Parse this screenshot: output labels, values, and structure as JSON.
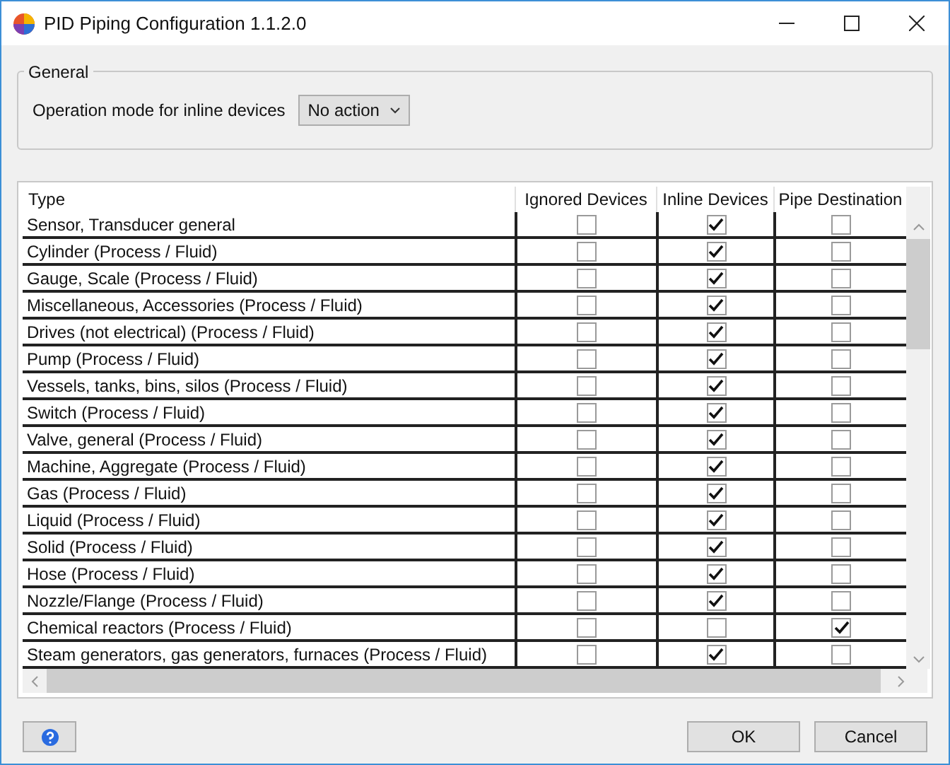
{
  "window": {
    "title": "PID Piping Configuration 1.1.2.0"
  },
  "general": {
    "title": "General",
    "label": "Operation mode for inline devices",
    "value": "No action"
  },
  "table": {
    "columns": [
      "Type",
      "Ignored Devices",
      "Inline Devices",
      "Pipe Destination"
    ],
    "rows": [
      {
        "type": "Sensor, Transducer general",
        "ignored": false,
        "inline": true,
        "pipe_destination": false
      },
      {
        "type": "Cylinder (Process / Fluid)",
        "ignored": false,
        "inline": true,
        "pipe_destination": false
      },
      {
        "type": "Gauge, Scale (Process / Fluid)",
        "ignored": false,
        "inline": true,
        "pipe_destination": false
      },
      {
        "type": "Miscellaneous, Accessories (Process / Fluid)",
        "ignored": false,
        "inline": true,
        "pipe_destination": false
      },
      {
        "type": "Drives (not electrical) (Process / Fluid)",
        "ignored": false,
        "inline": true,
        "pipe_destination": false
      },
      {
        "type": "Pump (Process / Fluid)",
        "ignored": false,
        "inline": true,
        "pipe_destination": false
      },
      {
        "type": "Vessels, tanks, bins, silos (Process / Fluid)",
        "ignored": false,
        "inline": true,
        "pipe_destination": false
      },
      {
        "type": "Switch (Process / Fluid)",
        "ignored": false,
        "inline": true,
        "pipe_destination": false
      },
      {
        "type": "Valve, general (Process / Fluid)",
        "ignored": false,
        "inline": true,
        "pipe_destination": false
      },
      {
        "type": "Machine, Aggregate (Process / Fluid)",
        "ignored": false,
        "inline": true,
        "pipe_destination": false
      },
      {
        "type": "Gas (Process / Fluid)",
        "ignored": false,
        "inline": true,
        "pipe_destination": false
      },
      {
        "type": "Liquid (Process / Fluid)",
        "ignored": false,
        "inline": true,
        "pipe_destination": false
      },
      {
        "type": "Solid (Process / Fluid)",
        "ignored": false,
        "inline": true,
        "pipe_destination": false
      },
      {
        "type": "Hose (Process / Fluid)",
        "ignored": false,
        "inline": true,
        "pipe_destination": false
      },
      {
        "type": "Nozzle/Flange (Process / Fluid)",
        "ignored": false,
        "inline": true,
        "pipe_destination": false
      },
      {
        "type": "Chemical reactors (Process / Fluid)",
        "ignored": false,
        "inline": false,
        "pipe_destination": true
      },
      {
        "type": "Steam generators, gas generators, furnaces (Process / Fluid)",
        "ignored": false,
        "inline": true,
        "pipe_destination": false
      }
    ]
  },
  "buttons": [
    "OK",
    "Cancel"
  ]
}
